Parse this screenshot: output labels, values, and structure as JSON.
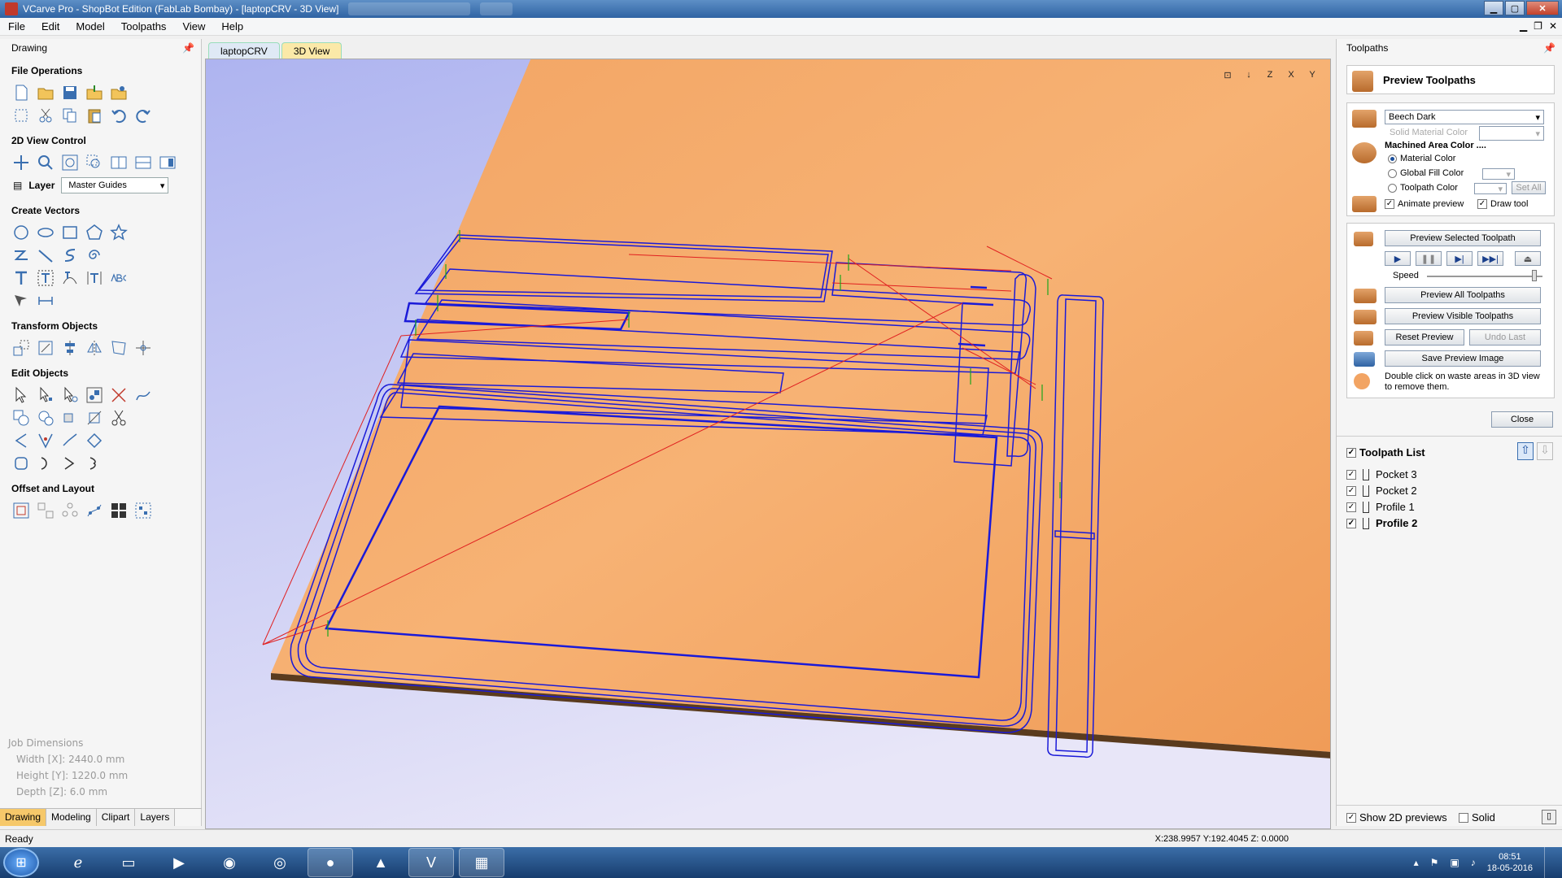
{
  "window": {
    "title": "VCarve Pro - ShopBot Edition (FabLab Bombay) - [laptopCRV - 3D View]"
  },
  "menu": [
    "File",
    "Edit",
    "Model",
    "Toolpaths",
    "View",
    "Help"
  ],
  "left_panel": {
    "header": "Drawing",
    "sections": {
      "file_ops": "File Operations",
      "view_2d": "2D View Control",
      "create_vectors": "Create Vectors",
      "transform": "Transform Objects",
      "edit": "Edit Objects",
      "offset": "Offset and Layout"
    },
    "layer_label": "Layer",
    "layer_value": "Master Guides",
    "job_dims": {
      "title": "Job Dimensions",
      "width": "Width  [X]: 2440.0 mm",
      "height": "Height [Y]: 1220.0 mm",
      "depth": "Depth  [Z]: 6.0 mm"
    },
    "bottom_tabs": [
      "Drawing",
      "Modeling",
      "Clipart",
      "Layers"
    ]
  },
  "doc_tabs": [
    "laptopCRV",
    "3D View"
  ],
  "view_icons": [
    "⊡",
    "↓",
    "Z",
    "X",
    "Y"
  ],
  "right_panel": {
    "header": "Toolpaths",
    "preview_title": "Preview Toolpaths",
    "material": "Beech Dark",
    "solid_material_color": "Solid Material Color",
    "machined_area_color": "Machined Area Color ....",
    "radio_material": "Material Color",
    "radio_global": "Global Fill Color",
    "radio_toolpath": "Toolpath Color",
    "set_all": "Set All",
    "animate_preview": "Animate preview",
    "draw_tool": "Draw tool",
    "preview_selected": "Preview Selected Toolpath",
    "speed": "Speed",
    "speed_level": 0.95,
    "preview_all": "Preview All Toolpaths",
    "preview_visible": "Preview Visible Toolpaths",
    "reset_preview": "Reset Preview",
    "undo_last": "Undo Last",
    "save_image": "Save Preview Image",
    "hint": "Double click on waste areas in 3D view to remove them.",
    "close": "Close",
    "toolpath_list_title": "Toolpath List",
    "toolpaths": [
      "Pocket 3",
      "Pocket 2",
      "Profile 1",
      "Profile 2"
    ],
    "show_2d": "Show 2D previews",
    "solid": "Solid"
  },
  "status": {
    "left": "Ready",
    "coords": "X:238.9957 Y:192.4045 Z: 0.0000"
  },
  "taskbar": {
    "time": "08:51",
    "date": "18-05-2016"
  }
}
